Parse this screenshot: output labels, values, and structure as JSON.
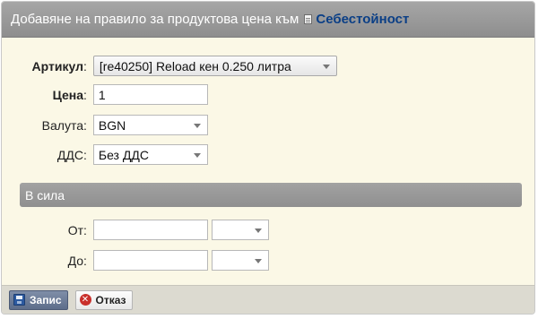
{
  "dialog": {
    "title": "Добавяне на правило за продуктова цена към",
    "title_link": "Себестойност"
  },
  "form": {
    "article": {
      "label": "Артикул",
      "value": "[re40250] Reload кен 0.250 литра"
    },
    "price": {
      "label": "Цена",
      "value": "1"
    },
    "currency": {
      "label": "Валута",
      "value": "BGN"
    },
    "vat": {
      "label": "ДДС",
      "value": "Без ДДС"
    }
  },
  "section": {
    "title": "В сила"
  },
  "validity": {
    "from": {
      "label": "От",
      "date": "",
      "time": ""
    },
    "to": {
      "label": "До",
      "date": "",
      "time": ""
    }
  },
  "footer": {
    "save_label": "Запис",
    "cancel_label": "Отказ"
  }
}
